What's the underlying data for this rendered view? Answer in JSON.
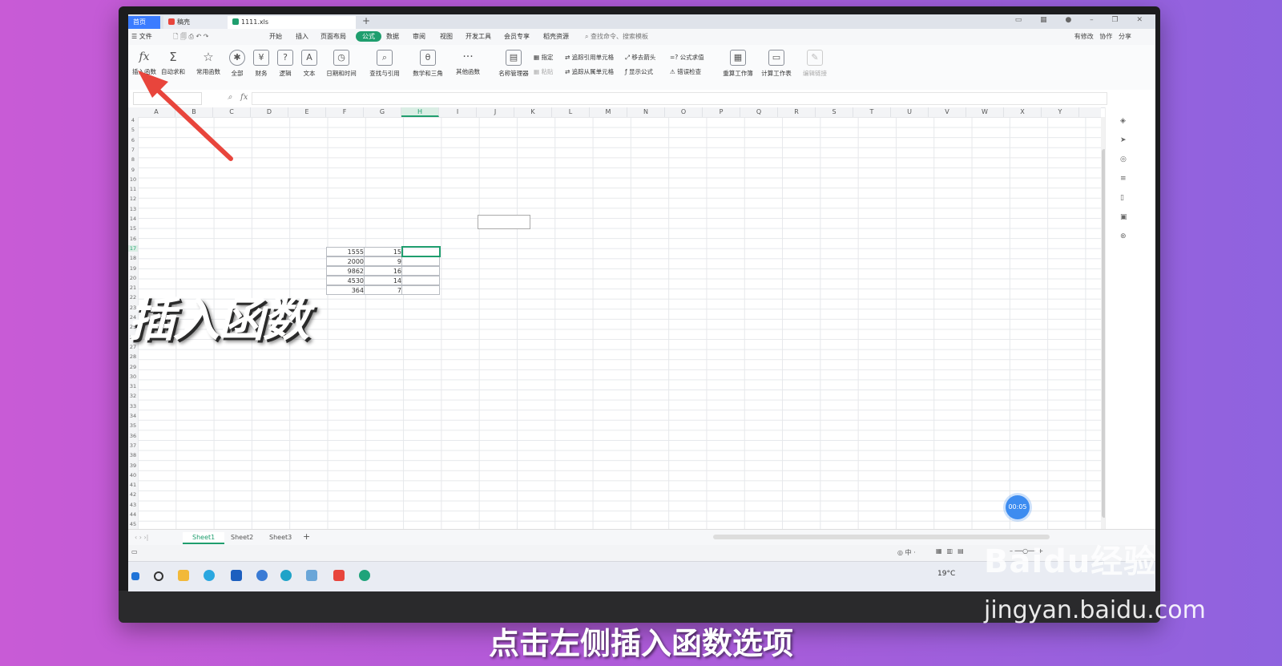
{
  "titlebar": {
    "home_tab": "首页",
    "doc_tab": "稿壳",
    "file_tab": "1111.xls",
    "new_tab": "+"
  },
  "menu": {
    "file": "文件",
    "items": [
      "开始",
      "插入",
      "页面布局",
      "公式",
      "数据",
      "审阅",
      "视图",
      "开发工具",
      "会员专享",
      "稻壳资源"
    ],
    "active": "公式",
    "search": "查找命令、搜索模板",
    "right": [
      "有修改",
      "协作",
      "分享"
    ]
  },
  "ribbon": {
    "buttons": [
      {
        "label": "插入函数",
        "icon": "fx-icon"
      },
      {
        "label": "自动求和",
        "icon": "sigma-icon"
      },
      {
        "label": "常用函数",
        "icon": "star-icon"
      },
      {
        "label": "全部",
        "icon": "asterisk-icon"
      },
      {
        "label": "财务",
        "icon": "finance-icon"
      },
      {
        "label": "逻辑",
        "icon": "question-icon"
      },
      {
        "label": "文本",
        "icon": "text-icon"
      },
      {
        "label": "日期和时间",
        "icon": "clock-icon"
      },
      {
        "label": "查找与引用",
        "icon": "magnifier-icon"
      },
      {
        "label": "数学和三角",
        "icon": "math-icon"
      },
      {
        "label": "其他函数",
        "icon": "more-icon"
      },
      {
        "label": "名称管理器",
        "icon": "name-manager-icon"
      }
    ],
    "small": {
      "specify": "指定",
      "paste": "粘贴",
      "trace_precedents": "追踪引用单元格",
      "trace_dependents": "追踪从属单元格",
      "remove_arrows": "移去箭头",
      "show_formulas": "显示公式",
      "eval_formula": "公式求值",
      "error_check": "错误检查"
    },
    "recalc": "重算工作簿",
    "calc_sheet": "计算工作表",
    "edit_links": "编辑链接"
  },
  "formula": {
    "fx": "fx"
  },
  "columns": [
    "A",
    "B",
    "C",
    "D",
    "E",
    "F",
    "G",
    "H",
    "I",
    "J",
    "K",
    "L",
    "M",
    "N",
    "O",
    "P",
    "Q",
    "R",
    "S",
    "T",
    "U",
    "V",
    "W",
    "X",
    "Y"
  ],
  "rows": [
    "4",
    "5",
    "6",
    "7",
    "8",
    "9",
    "10",
    "11",
    "12",
    "13",
    "14",
    "15",
    "16",
    "17",
    "18",
    "19",
    "20",
    "21",
    "22",
    "23",
    "24",
    "25",
    "26",
    "27",
    "28",
    "29",
    "30",
    "31",
    "32",
    "33",
    "34",
    "35",
    "36",
    "37",
    "38",
    "39",
    "40",
    "41",
    "42",
    "43",
    "44",
    "45"
  ],
  "cells": {
    "col_f": [
      "1555",
      "2000",
      "9862",
      "4530",
      "364"
    ],
    "col_g": [
      "15",
      "9",
      "16",
      "14",
      "7"
    ]
  },
  "sheets": [
    "Sheet1",
    "Sheet2",
    "Sheet3"
  ],
  "add_sheet": "+",
  "taskbar": {
    "weather": "19°C"
  },
  "timer": "00:05",
  "overlay": {
    "caption": "插入函数",
    "subtitle": "点击左侧插入函数选项"
  },
  "watermark": {
    "logo": "Baidu经验",
    "url": "jingyan.baidu.com"
  },
  "colors": {
    "accent": "#1f9e6e",
    "arrow": "#e8453c",
    "timer": "#3d8cf0"
  }
}
